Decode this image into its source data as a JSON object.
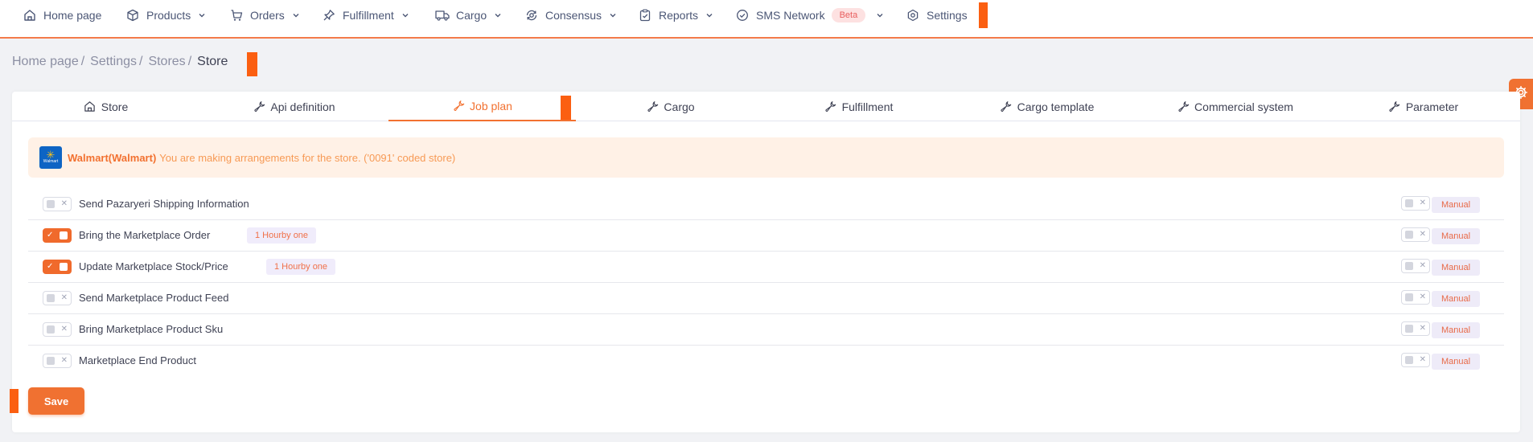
{
  "nav": {
    "items": [
      {
        "label": "Home page",
        "icon": "home-icon",
        "has_dropdown": false
      },
      {
        "label": "Products",
        "icon": "box-icon",
        "has_dropdown": true
      },
      {
        "label": "Orders",
        "icon": "cart-icon",
        "has_dropdown": true
      },
      {
        "label": "Fulfillment",
        "icon": "pin-icon",
        "has_dropdown": true
      },
      {
        "label": "Cargo",
        "icon": "truck-icon",
        "has_dropdown": true
      },
      {
        "label": "Consensus",
        "icon": "consensus-icon",
        "has_dropdown": true
      },
      {
        "label": "Reports",
        "icon": "clipboard-icon",
        "has_dropdown": true
      },
      {
        "label": "SMS Network",
        "icon": "check-circle-icon",
        "has_dropdown": true,
        "badge": "Beta"
      },
      {
        "label": "Settings",
        "icon": "gear-icon",
        "has_dropdown": false
      }
    ]
  },
  "breadcrumb": {
    "items": [
      "Home page",
      "Settings",
      "Stores"
    ],
    "current": "Store"
  },
  "tabs": [
    {
      "label": "Store",
      "icon": "home-icon",
      "active": false
    },
    {
      "label": "Api definition",
      "icon": "wrench-icon",
      "active": false
    },
    {
      "label": "Job plan",
      "icon": "wrench-icon",
      "active": true
    },
    {
      "label": "Cargo",
      "icon": "wrench-icon",
      "active": false
    },
    {
      "label": "Fulfillment",
      "icon": "wrench-icon",
      "active": false
    },
    {
      "label": "Cargo template",
      "icon": "wrench-icon",
      "active": false
    },
    {
      "label": "Commercial system",
      "icon": "wrench-icon",
      "active": false
    },
    {
      "label": "Parameter",
      "icon": "wrench-icon",
      "active": false
    }
  ],
  "notice": {
    "store_name": "Walmart(Walmart)",
    "message": "You are making arrangements for the store. ('0091' coded store)",
    "logo_text": "Walmart"
  },
  "jobs": [
    {
      "label": "Send Pazaryeri Shipping Information",
      "enabled": false,
      "frequency": "",
      "mode": "Manual"
    },
    {
      "label": "Bring the Marketplace Order",
      "enabled": true,
      "frequency": "1 Hourby one",
      "mode": "Manual"
    },
    {
      "label": "Update Marketplace Stock/Price",
      "enabled": true,
      "frequency": "1 Hourby one",
      "mode": "Manual"
    },
    {
      "label": "Send Marketplace Product Feed",
      "enabled": false,
      "frequency": "",
      "mode": "Manual"
    },
    {
      "label": "Bring Marketplace Product Sku",
      "enabled": false,
      "frequency": "",
      "mode": "Manual"
    },
    {
      "label": "Marketplace End Product",
      "enabled": false,
      "frequency": "",
      "mode": "Manual"
    }
  ],
  "actions": {
    "save_label": "Save"
  },
  "colors": {
    "accent": "#f07131",
    "nav_border": "#f47b4a",
    "notice_bg": "#fff1e6",
    "marker": "#fb5f11"
  }
}
